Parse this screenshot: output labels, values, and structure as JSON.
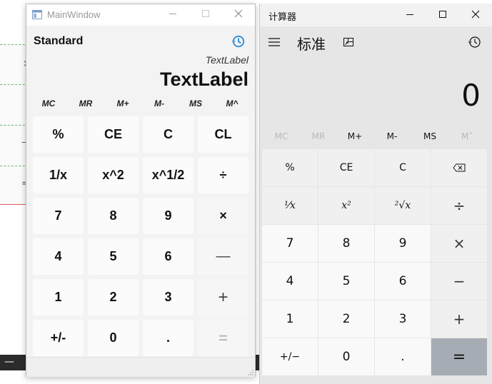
{
  "background": {
    "glyphs": [
      "×",
      "—",
      "="
    ]
  },
  "main_window": {
    "title": "MainWindow",
    "mode_label": "Standard",
    "expression_label": "TextLabel",
    "display_label": "TextLabel",
    "memory_buttons": [
      "MC",
      "MR",
      "M+",
      "M-",
      "MS",
      "M^"
    ],
    "keys": [
      [
        "%",
        "CE",
        "C",
        "CL"
      ],
      [
        "1/x",
        "x^2",
        "x^1/2",
        "÷"
      ],
      [
        "7",
        "8",
        "9",
        "×"
      ],
      [
        "4",
        "5",
        "6",
        "—"
      ],
      [
        "1",
        "2",
        "3",
        "+"
      ],
      [
        "+/-",
        "0",
        ".",
        "="
      ]
    ],
    "colors": {
      "accent": "#2b8bd6"
    }
  },
  "win_calculator": {
    "title": "计算器",
    "mode_label": "标准",
    "display_value": "0",
    "memory_buttons": [
      "MC",
      "MR",
      "M+",
      "M-",
      "MS",
      "M˅"
    ],
    "keys": [
      [
        "%",
        "CE",
        "C",
        "⌫"
      ],
      [
        "¹⁄x",
        "x²",
        "²√x",
        "÷"
      ],
      [
        "7",
        "8",
        "9",
        "×"
      ],
      [
        "4",
        "5",
        "6",
        "−"
      ],
      [
        "1",
        "2",
        "3",
        "+"
      ],
      [
        "+/−",
        "0",
        ".",
        "="
      ]
    ],
    "colors": {
      "equals_bg": "#a6acb4"
    }
  }
}
